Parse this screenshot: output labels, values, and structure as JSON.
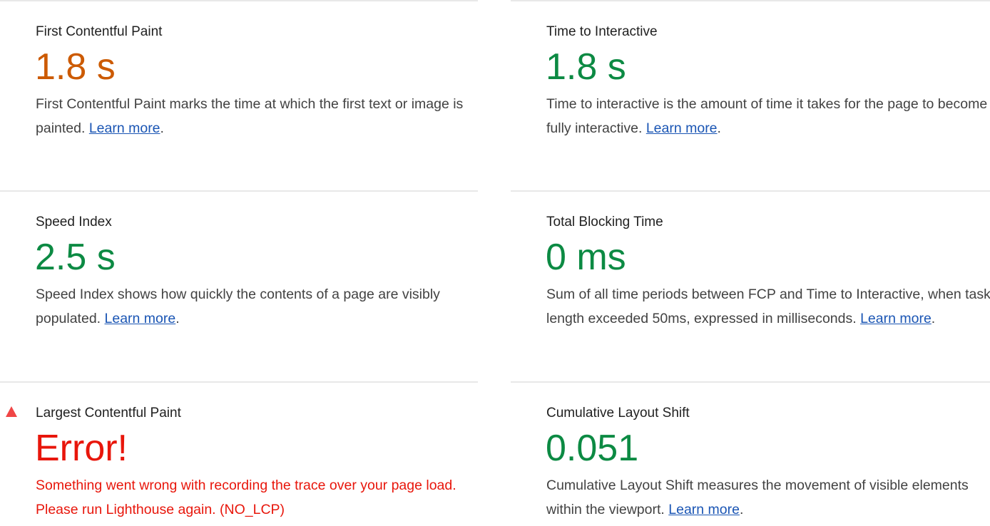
{
  "colors": {
    "average": "#cc5a00",
    "good": "#0c8a43",
    "error": "#e8160b",
    "link": "#1a55b4"
  },
  "metrics": [
    {
      "title": "First Contentful Paint",
      "value": "1.8 s",
      "status": "average",
      "desc_prefix": "First Contentful Paint marks the time at which the first text or image is painted. ",
      "link": "Learn more",
      "desc_suffix": "."
    },
    {
      "title": "Time to Interactive",
      "value": "1.8 s",
      "status": "good",
      "desc_prefix": "Time to interactive is the amount of time it takes for the page to become fully interactive. ",
      "link": "Learn more",
      "desc_suffix": "."
    },
    {
      "title": "Speed Index",
      "value": "2.5 s",
      "status": "good",
      "desc_prefix": "Speed Index shows how quickly the contents of a page are visibly populated. ",
      "link": "Learn more",
      "desc_suffix": "."
    },
    {
      "title": "Total Blocking Time",
      "value": "0 ms",
      "status": "good",
      "desc_prefix": "Sum of all time periods between FCP and Time to Interactive, when task length exceeded 50ms, expressed in milliseconds. ",
      "link": "Learn more",
      "desc_suffix": "."
    },
    {
      "title": "Largest Contentful Paint",
      "value": "Error!",
      "status": "error",
      "icon": "warning-triangle-icon",
      "desc_prefix": "Something went wrong with recording the trace over your page load. Please run Lighthouse again. (NO_LCP)",
      "link": "",
      "desc_suffix": ""
    },
    {
      "title": "Cumulative Layout Shift",
      "value": "0.051",
      "status": "good",
      "desc_prefix": "Cumulative Layout Shift measures the movement of visible elements within the viewport. ",
      "link": "Learn more",
      "desc_suffix": "."
    }
  ]
}
